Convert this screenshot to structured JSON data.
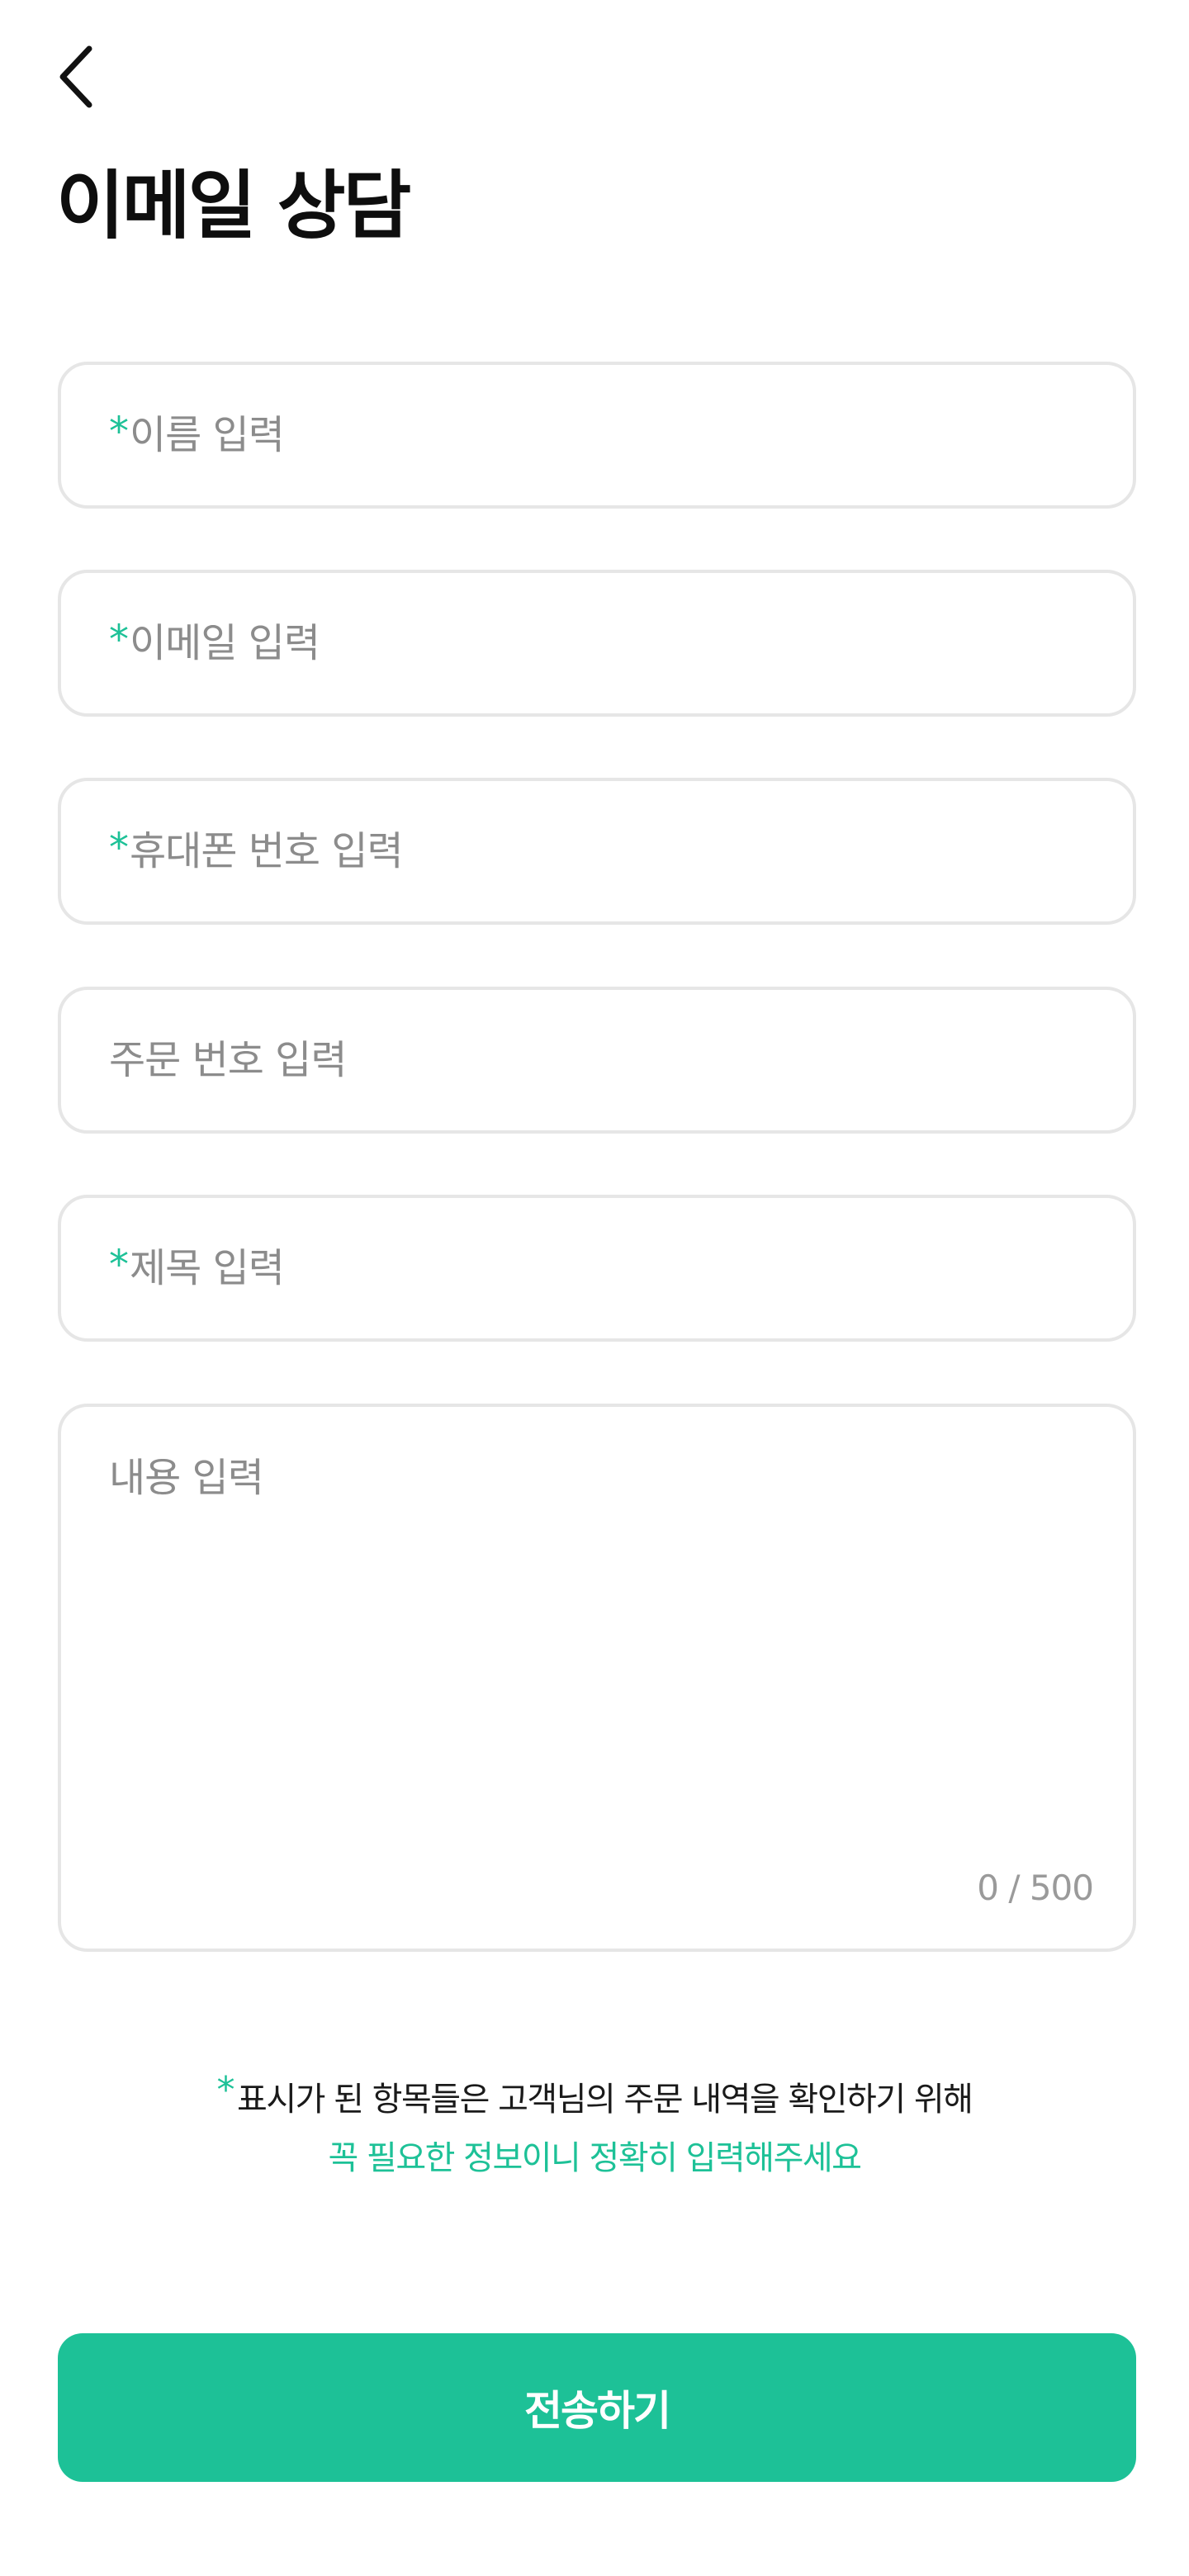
{
  "header": {
    "title": "이메일 상담",
    "back_icon": "chevron-left-icon"
  },
  "form": {
    "required_mark": "*",
    "name_placeholder": "이름 입력",
    "email_placeholder": "이메일 입력",
    "phone_placeholder": "휴대폰 번호 입력",
    "order_placeholder": "주문 번호 입력",
    "subject_placeholder": "제목 입력",
    "content_placeholder": "내용 입력",
    "content_counter": "0 / 500"
  },
  "notice": {
    "mark": "*",
    "line1": "표시가 된 항목들은 고객님의 주문 내역을 확인하기 위해",
    "line2": "꼭 필요한 정보이니 정확히 입력해주세요"
  },
  "submit": {
    "label": "전송하기"
  },
  "colors": {
    "accent": "#1dc197",
    "border": "#e6e6e6",
    "placeholder": "#8c8c8c"
  }
}
